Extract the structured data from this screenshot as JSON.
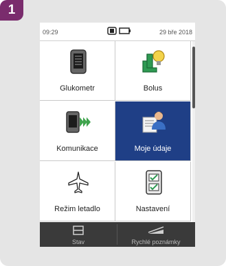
{
  "step": "1",
  "status": {
    "time": "09:29",
    "date": "29 bře 2018"
  },
  "tiles": [
    {
      "label": "Glukometr",
      "icon": "meter-icon"
    },
    {
      "label": "Bolus",
      "icon": "bolus-icon"
    },
    {
      "label": "Komunikace",
      "icon": "communication-icon"
    },
    {
      "label": "Moje údaje",
      "icon": "my-data-icon",
      "selected": true
    },
    {
      "label": "Režim letadlo",
      "icon": "airplane-icon"
    },
    {
      "label": "Nastavení",
      "icon": "settings-icon"
    }
  ],
  "bottom": {
    "stav": "Stav",
    "notes": "Rychlé poznámky"
  },
  "colors": {
    "badge": "#7a2c6d",
    "selected": "#1f3f86",
    "bar": "#3a3a3a"
  }
}
